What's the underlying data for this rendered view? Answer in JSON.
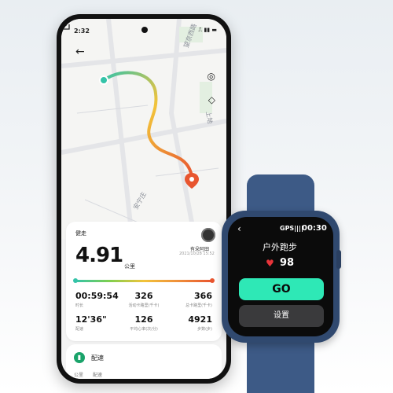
{
  "phone": {
    "status": {
      "time": "2:32",
      "icons": "⎍ ▮▮ ▬"
    },
    "map": {
      "road_labels": [
        "安宁庄",
        "望京西路",
        "上地"
      ],
      "route_colors": {
        "start": "#34c3a8",
        "mid": "#f2c33a",
        "end": "#e8552f"
      }
    },
    "summary": {
      "activity_type": "健走",
      "distance": "4.91",
      "distance_unit": "公里",
      "user_name": "有朵阿田",
      "date": "2021/10/28 15:52",
      "stats": [
        {
          "value": "00:59:54",
          "label": "时长"
        },
        {
          "value": "326",
          "label": "活动卡路里(千卡)"
        },
        {
          "value": "366",
          "label": "总卡路里(千卡)"
        },
        {
          "value": "12'36\"",
          "label": "配速"
        },
        {
          "value": "126",
          "label": "平均心率(次/分)"
        },
        {
          "value": "4921",
          "label": "步数(步)"
        }
      ]
    },
    "pace": {
      "title": "配速",
      "col_km": "公里",
      "col_speed": "配速"
    }
  },
  "watch": {
    "back_icon": "‹",
    "gps": "GPS",
    "gps_bars": "||||",
    "time": "00:30",
    "mode": "户外跑步",
    "heart_rate": "98",
    "go_label": "GO",
    "settings_label": "设置",
    "colors": {
      "go": "#2ee8b6",
      "heart": "#e8343a",
      "band": "#3d5a86"
    }
  }
}
